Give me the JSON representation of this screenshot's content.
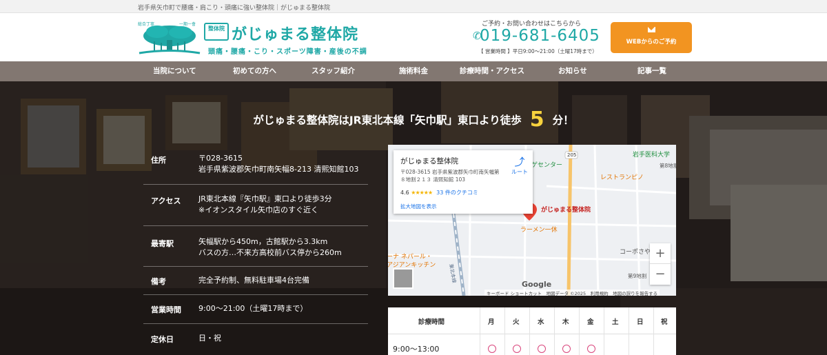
{
  "topbar": {
    "text": "岩手県矢巾町で腰痛・肩こり・頭痛に強い整体院｜がじゅまる整体院"
  },
  "logo": {
    "small_left": "総合丁寧",
    "small_right": "一期一會",
    "mark": "整体院",
    "name": "がじゅまる整体院",
    "tagline": "頭痛・腰痛・こり・スポーツ障害・産後の不調"
  },
  "contact": {
    "label": "ご予約・お問い合わせはこちらから",
    "phone": "019-681-6405",
    "hours": "【 営業時間 】平日9:00～21:00（土曜17時まで）"
  },
  "web_button": {
    "label": "WEBからのご予約"
  },
  "nav": {
    "items": [
      "当院について",
      "初めての方へ",
      "スタッフ紹介",
      "施術料金",
      "診療時間・アクセス",
      "お知らせ",
      "記事一覧"
    ]
  },
  "headline": {
    "before": "がじゅまる整体院はJR東北本線「矢巾駅」東口より徒歩",
    "minutes": "5",
    "after": "分！"
  },
  "info": [
    {
      "key": "住所",
      "lines": [
        "〒028-3615",
        "岩手県紫波郡矢巾町南矢幅8-213 清熙知館103"
      ]
    },
    {
      "key": "アクセス",
      "lines": [
        "JR東北本線『矢巾駅』東口より徒歩3分",
        "※イオンスタイル矢巾店のすぐ近く"
      ]
    },
    {
      "key": "最寄駅",
      "lines": [
        "矢幅駅から450m，古館駅から3.3km",
        "バスの方…不来方高校前バス停から260m"
      ]
    },
    {
      "key": "備考",
      "lines": [
        "完全予約制、無料駐車場4台完備"
      ]
    },
    {
      "key": "営業時間",
      "lines": [
        "9:00～21:00（土曜17時まで）"
      ]
    },
    {
      "key": "定休日",
      "lines": [
        "日・祝"
      ]
    }
  ],
  "map": {
    "card": {
      "name": "がじゅまる整体院",
      "address": "〒028-3615 岩手県紫波郡矢巾町南矢幅第８地割２１３ 清熙知館 103",
      "rating": "4.6",
      "stars": "★★★★★",
      "reviews": "33 件のクチコミ",
      "enlarge": "拡大地図を表示",
      "route": "ルート"
    },
    "pois": {
      "marker": "がじゅまる整体院",
      "ramen": "ラーメン一休",
      "restaurant": "レストランピノ",
      "iwate": "岩手医科大学",
      "center": "ゲセンター",
      "nepal": "ーナ ネパール・",
      "asian": "アジアンキッチン",
      "corpo": "コーポさや",
      "chiwari9": "第9地割",
      "chiwari8": "第8地割",
      "road": "205",
      "rail": "東北本線",
      "google": "Google"
    },
    "attribution": "キーボード ショートカット　地図データ ©2025　利用規約　地図の誤りを報告する",
    "zoom_in": "+",
    "zoom_out": "−"
  },
  "schedule": {
    "header": [
      "診療時間",
      "月",
      "火",
      "水",
      "木",
      "金",
      "土",
      "日",
      "祝"
    ],
    "row_label": "9:00～13:00",
    "marks": [
      true,
      true,
      true,
      true,
      true,
      false,
      false,
      false
    ]
  },
  "colors": {
    "teal": "#1fa8a6",
    "orange": "#f29421",
    "nav": "#827771",
    "accent_yellow": "#f7d23e",
    "circle": "#d9447b"
  }
}
